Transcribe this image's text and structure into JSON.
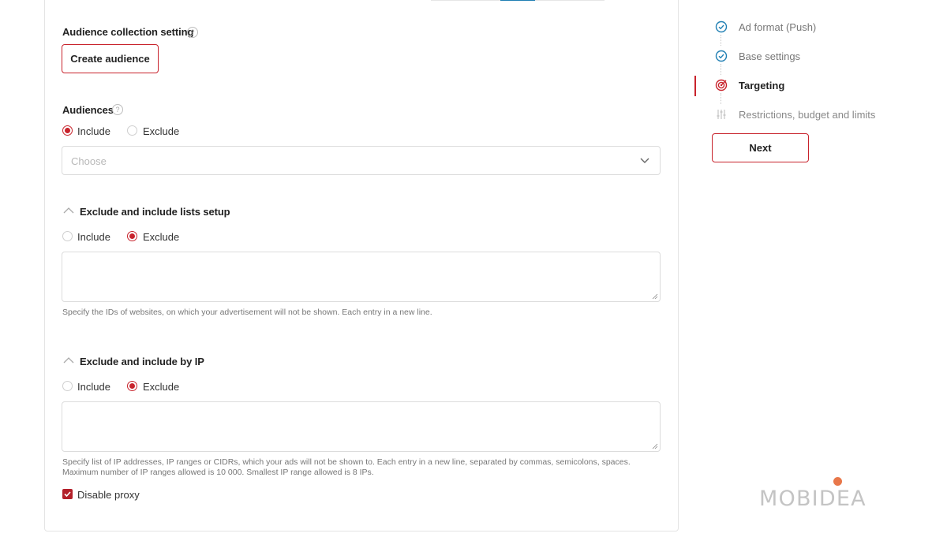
{
  "audience_collection": {
    "title": "Audience collection setting",
    "help_icon": "question-circle-icon",
    "create_button": "Create audience"
  },
  "audiences": {
    "title": "Audiences",
    "help_icon": "question-circle-icon",
    "include_label": "Include",
    "exclude_label": "Exclude",
    "selected": "Include",
    "select_placeholder": "Choose",
    "select_icon": "chevron-down-icon"
  },
  "lists_setup": {
    "title": "Exclude and include lists setup",
    "toggle_icon": "chevron-up-icon",
    "include_label": "Include",
    "exclude_label": "Exclude",
    "selected": "Exclude",
    "textarea_value": "",
    "hint": "Specify the IDs of websites, on which your advertisement will not be shown. Each entry in a new line."
  },
  "ip_setup": {
    "title": "Exclude and include by IP",
    "toggle_icon": "chevron-up-icon",
    "include_label": "Include",
    "exclude_label": "Exclude",
    "selected": "Exclude",
    "textarea_value": "",
    "hint_line1": "Specify list of IP addresses, IP ranges or CIDRs, which your ads will not be shown to. Each entry in a new line, separated by commas, semicolons, spaces.",
    "hint_line2": "Maximum number of IP ranges allowed is 10 000. Smallest IP range allowed is 8 IPs.",
    "disable_proxy_label": "Disable proxy",
    "disable_proxy_checked": true
  },
  "stepper": {
    "steps": [
      {
        "label": "Ad format (Push)",
        "status": "done",
        "icon": "check-circle-icon"
      },
      {
        "label": "Base settings",
        "status": "done",
        "icon": "check-circle-icon"
      },
      {
        "label": "Targeting",
        "status": "active",
        "icon": "target-icon"
      },
      {
        "label": "Restrictions, budget and limits",
        "status": "pending",
        "icon": "sliders-icon"
      }
    ],
    "next_button": "Next"
  },
  "logo": {
    "text": "MOBIDEA"
  },
  "colors": {
    "accent_red": "#c8232c",
    "check_blue": "#1f7fb3",
    "logo_orange": "#e8774a",
    "logo_gray": "#c4c4c4"
  }
}
